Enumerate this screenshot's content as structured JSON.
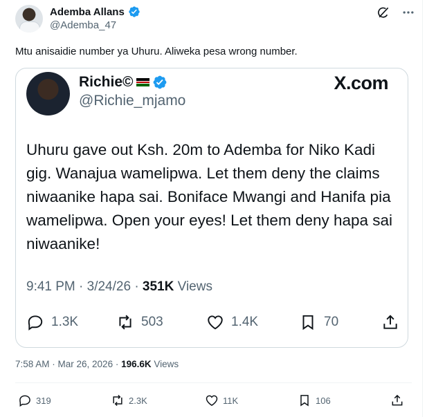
{
  "tweet": {
    "name": "Ademba Allans",
    "handle": "@Ademba_47",
    "text": "Mtu anisaidie number ya Uhuru. Aliweka pesa wrong number.",
    "time": "7:58 AM · Mar 26, 2026 · ",
    "views_count": "196.6K",
    "views_label": " Views",
    "replies": "319",
    "reposts": "2.3K",
    "likes": "11K",
    "bookmarks": "106"
  },
  "quoted": {
    "name": "Richie©",
    "handle": "@Richie_mjamo",
    "brand": "X.com",
    "text": "Uhuru gave out Ksh. 20m to Ademba for Niko Kadi gig. Wanajua wamelipwa. Let them deny the claims niwaanike hapa sai. Boniface Mwangi and Hanifa pia wamelipwa. Open your eyes!  Let them deny hapa sai niwaanike!",
    "time": "9:41 PM · 3/24/26 · ",
    "views_count": "351K",
    "views_label": " Views",
    "replies": "1.3K",
    "reposts": "503",
    "likes": "1.4K",
    "bookmarks": "70"
  },
  "icons": {
    "verified": "verified-badge-icon",
    "grok": "grok-icon",
    "more": "more-icon",
    "reply": "reply-icon",
    "repost": "repost-icon",
    "like": "like-icon",
    "bookmark": "bookmark-icon",
    "share": "share-icon"
  },
  "colors": {
    "verified": "#1d9bf0",
    "text": "#0f1419",
    "secondary": "#536471",
    "border": "#cfd9de"
  }
}
